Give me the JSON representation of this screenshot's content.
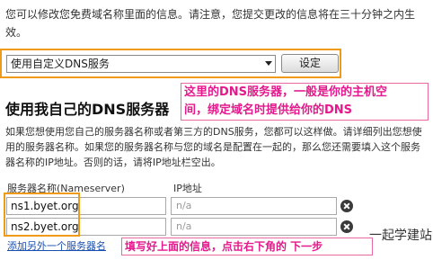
{
  "intro_text": "您可以修改您免费域名称里面的信息。请注意，您提交更改的信息将在三十分钟之内生效。",
  "dns_select": {
    "selected": "使用自定义DNS服务"
  },
  "set_button_label": "设定",
  "section_title": "使用我自己的DNS服务器",
  "description": "如果您想使用您自己的服务器名称或者第三方的DNS服务，您都可以这样做。请详细列出您想使用的服务器名称。如果您的服务器名称与您的域名是配置在一起的，那么您还需要填入这个服务器名称的IP地址。否则的话，请将IP地址栏空出。",
  "table_headers": {
    "nameserver": "服务器名称(Nameserver)",
    "ip": "IP地址"
  },
  "nameservers": [
    {
      "name": "ns1.byet.org",
      "ip_placeholder": "n/a"
    },
    {
      "name": "ns2.byet.org",
      "ip_placeholder": "n/a"
    }
  ],
  "add_link_label": "添加另外一个服务器名",
  "annotations": {
    "top_line1": "这里的DNS服务器，一般是你的主机空",
    "top_line2": "间，绑定域名时提供给你的DNS",
    "bottom": "填写好上面的信息，点击右下角的 下一步"
  },
  "watermark": "一起学建站",
  "colors": {
    "highlight": "#f09a1a",
    "annotation": "#e4198c",
    "link": "#1a4fb0"
  }
}
